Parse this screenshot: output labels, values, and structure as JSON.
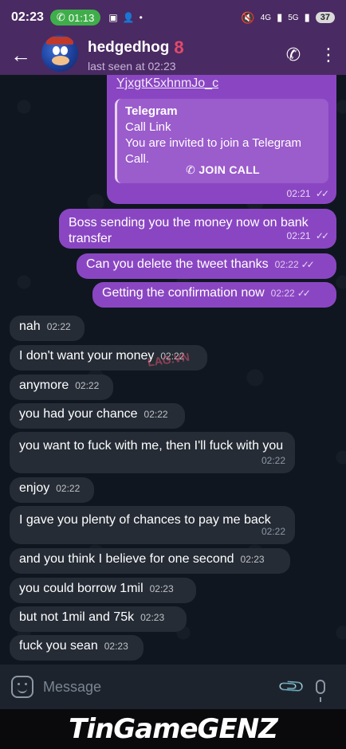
{
  "statusbar": {
    "time": "02:23",
    "call_time": "01:13",
    "network_1": "4G",
    "network_2": "5G",
    "battery": "37"
  },
  "header": {
    "contact_name": "hedgedhog",
    "badge": "8",
    "status": "last seen at 02:23"
  },
  "call_link_message": {
    "link_fragment": "YjxgtK5xhnmJo_c",
    "preview_title": "Telegram",
    "preview_subtitle": "Call Link",
    "preview_text": "You are invited to join a Telegram Call.",
    "join_label": "JOIN CALL",
    "time": "02:21"
  },
  "outgoing": [
    {
      "text": "Boss sending you the money now on bank transfer",
      "time": "02:21"
    },
    {
      "text": "Can you delete the tweet thanks",
      "time": "02:22"
    },
    {
      "text": "Getting the confirmation now",
      "time": "02:22"
    }
  ],
  "incoming": [
    {
      "text": "nah",
      "time": "02:22"
    },
    {
      "text": "I don't want your money",
      "time": "02:22"
    },
    {
      "text": "anymore",
      "time": "02:22"
    },
    {
      "text": "you had your chance",
      "time": "02:22"
    },
    {
      "text": "you want to fuck with me, then I'll fuck with you",
      "time": "02:22"
    },
    {
      "text": "enjoy",
      "time": "02:22"
    },
    {
      "text": "I gave you plenty of chances to pay me back",
      "time": "02:22"
    },
    {
      "text": "and you think I believe for one second",
      "time": "02:23"
    },
    {
      "text": "you could borrow 1mil",
      "time": "02:23"
    },
    {
      "text": "but not 1mil and 75k",
      "time": "02:23"
    },
    {
      "text": "fuck you sean",
      "time": "02:23"
    }
  ],
  "watermark_small": "LAG.VN",
  "input": {
    "placeholder": "Message"
  },
  "banner": {
    "text": "TinGameGENZ"
  },
  "colors": {
    "header_bg": "#4a2a62",
    "outgoing_bubble": "#8a46c2",
    "incoming_bubble": "#252c36",
    "chat_bg": "#0f1620"
  }
}
